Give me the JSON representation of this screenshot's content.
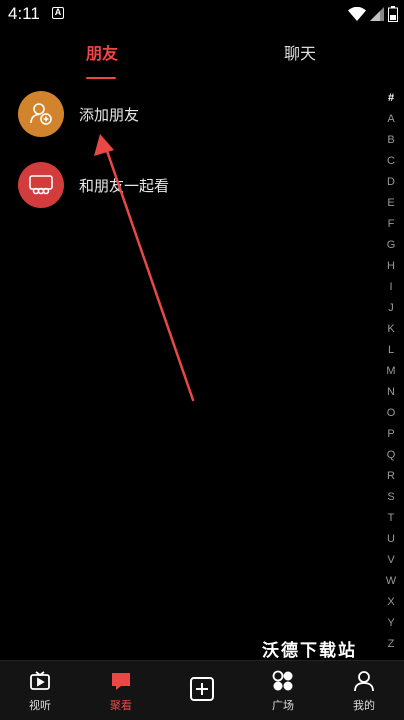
{
  "status_bar": {
    "time": "4:11",
    "notification_icon": "A"
  },
  "tabs": {
    "friends": "朋友",
    "chat": "聊天"
  },
  "list": [
    {
      "label": "添加朋友",
      "icon": "add-friend-icon",
      "color": "#d2842c"
    },
    {
      "label": "和朋友一起看",
      "icon": "watch-together-icon",
      "color": "#d23c3c"
    }
  ],
  "alphabet": [
    "#",
    "A",
    "B",
    "C",
    "D",
    "E",
    "F",
    "G",
    "H",
    "I",
    "J",
    "K",
    "L",
    "M",
    "N",
    "O",
    "P",
    "Q",
    "R",
    "S",
    "T",
    "U",
    "V",
    "W",
    "X",
    "Y",
    "Z"
  ],
  "watermark": "沃德下载站",
  "bottom_nav": [
    {
      "label": "视听",
      "icon": "tv-icon"
    },
    {
      "label": "聚看",
      "icon": "chat-bubble-icon",
      "active": true
    },
    {
      "label": "",
      "icon": "add-box-icon"
    },
    {
      "label": "广场",
      "icon": "square-icon"
    },
    {
      "label": "我的",
      "icon": "person-icon"
    }
  ],
  "colors": {
    "accent": "#f04545",
    "background": "#000000"
  }
}
